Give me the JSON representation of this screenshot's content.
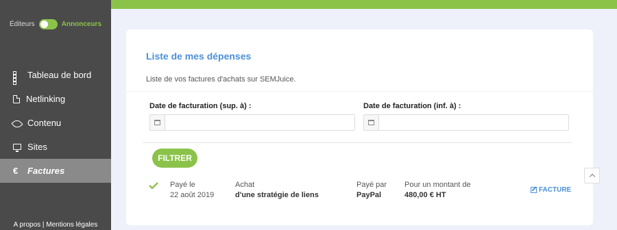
{
  "sidebar": {
    "mode_left": "Éditeurs",
    "mode_right": "Annonceurs",
    "items": [
      {
        "label": "Tableau de bord",
        "icon": "dashboard-icon"
      },
      {
        "label": "Netlinking",
        "icon": "document-icon"
      },
      {
        "label": "Contenu",
        "icon": "feather-icon"
      },
      {
        "label": "Sites",
        "icon": "monitor-icon"
      },
      {
        "label": "Factures",
        "icon": "euro-icon",
        "active": true
      }
    ],
    "euro_glyph": "€",
    "footer": "A propos | Mentions légales"
  },
  "main": {
    "title": "Liste de mes dépenses",
    "subtitle": "Liste de vos factures d'achats sur SEMJuice.",
    "filter_from_label": "Date de facturation (sup. à) :",
    "filter_to_label": "Date de facturation (inf. à) :",
    "filter_from_value": "",
    "filter_to_value": "",
    "filter_button": "FILTRER"
  },
  "invoice": {
    "status_label": "Payé le",
    "date": "22 août 2019",
    "type_label": "Achat",
    "type_value": "d'une stratégie de liens",
    "method_label": "Payé par",
    "method_value": "PayPal",
    "amount_label": "Pour un montant de",
    "amount_value": "480,00 € HT",
    "link_label": "FACTURE"
  },
  "colors": {
    "accent_green": "#8bc34a",
    "accent_blue": "#4a90d9",
    "sidebar_bg": "#4a4a4a"
  }
}
